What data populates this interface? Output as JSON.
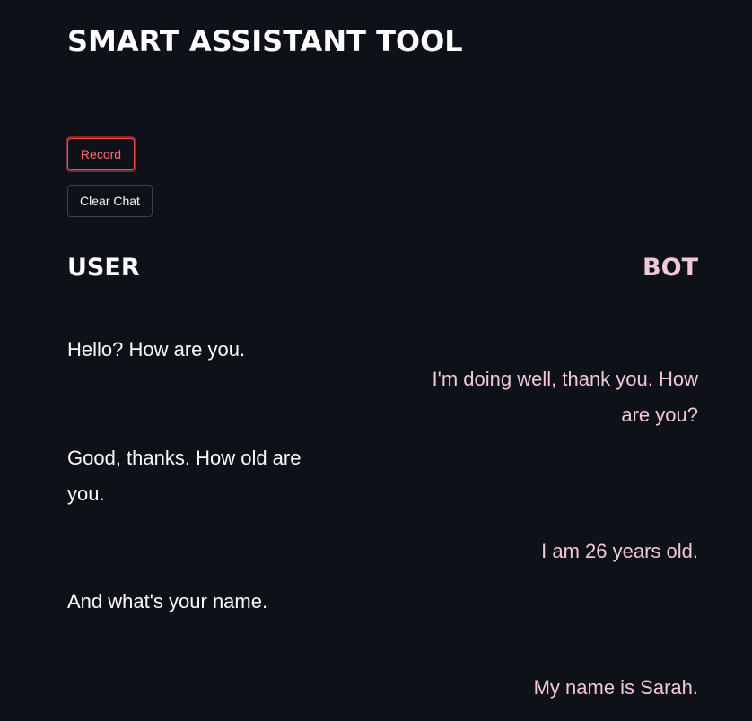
{
  "app": {
    "title": "SMART ASSISTANT TOOL"
  },
  "controls": {
    "record_label": "Record",
    "clear_label": "Clear Chat"
  },
  "columns": {
    "user_heading": "USER",
    "bot_heading": "BOT"
  },
  "colors": {
    "background": "#0e1117",
    "record_accent": "#ff4b4b",
    "bot_text": "#f0c8d8",
    "user_text": "#fafafa"
  },
  "chat": {
    "messages": [
      {
        "role": "user",
        "text": "Hello? How are you."
      },
      {
        "role": "bot",
        "text": "I'm doing well, thank you. How are you?"
      },
      {
        "role": "user",
        "text": "Good, thanks. How old are you."
      },
      {
        "role": "bot",
        "text": "I am 26 years old."
      },
      {
        "role": "user",
        "text": "And what's your name."
      },
      {
        "role": "bot",
        "text": "My name is Sarah."
      }
    ]
  }
}
